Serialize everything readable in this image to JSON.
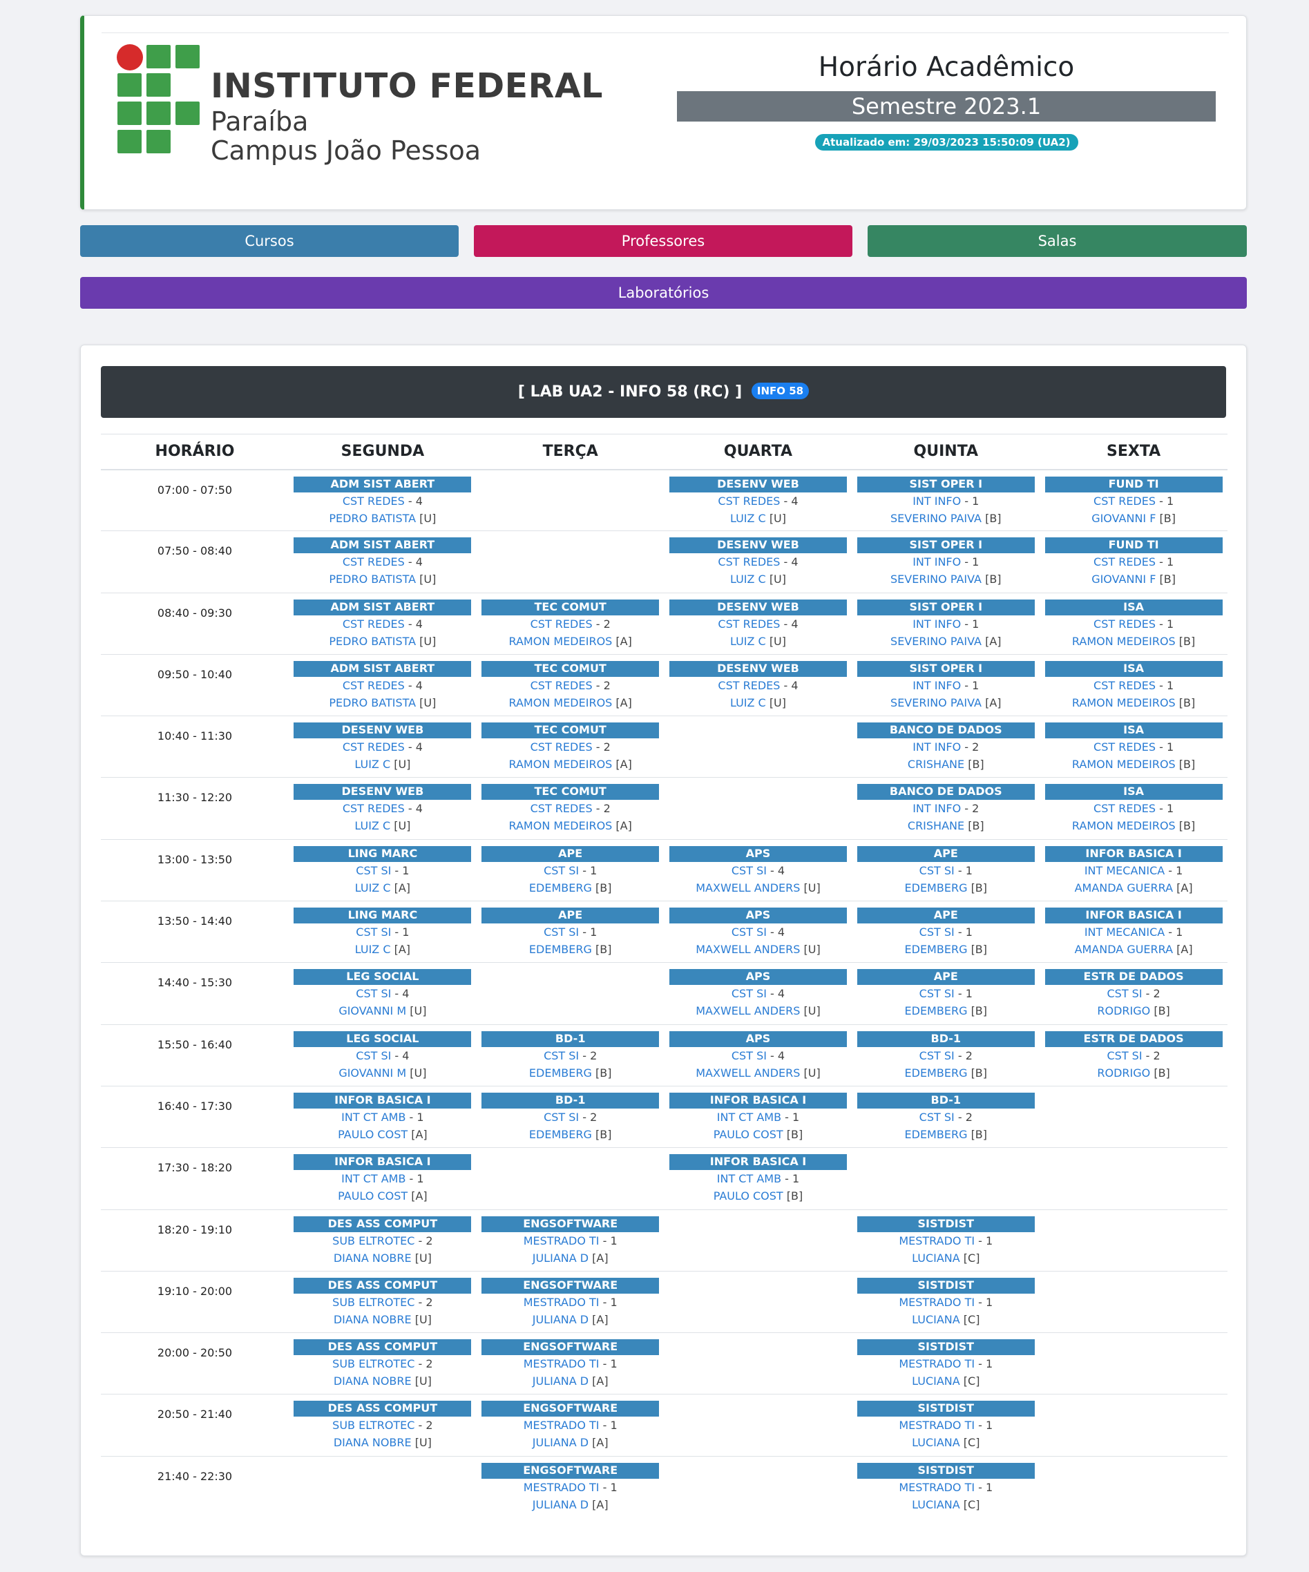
{
  "header": {
    "institution": "INSTITUTO FEDERAL",
    "state": "Paraíba",
    "campus": "Campus João Pessoa",
    "title": "Horário Acadêmico",
    "semester": "Semestre 2023.1",
    "updated": "Atualizado em: 29/03/2023 15:50:09 (UA2)"
  },
  "nav": {
    "cursos": "Cursos",
    "professores": "Professores",
    "salas": "Salas",
    "laboratorios": "Laboratórios"
  },
  "colors": {
    "cursos": "#3b7eab",
    "professores": "#c3185a",
    "salas": "#368662",
    "laboratorios": "#6a3bae",
    "discipline": "#3a87bb",
    "link": "#2a7cd4"
  },
  "room": {
    "title": "[ LAB UA2 - INFO 58 (RC) ]",
    "badge": "INFO 58"
  },
  "table": {
    "headers": [
      "HORÁRIO",
      "SEGUNDA",
      "TERÇA",
      "QUARTA",
      "QUINTA",
      "SEXTA"
    ],
    "rows": [
      {
        "time": "07:00 - 07:50",
        "days": [
          {
            "disc": "ADM SIST ABERT",
            "curso": "CST REDES",
            "periodo": "4",
            "prof": "PEDRO BATISTA",
            "turma": "[U]"
          },
          null,
          {
            "disc": "DESENV WEB",
            "curso": "CST REDES",
            "periodo": "4",
            "prof": "LUIZ C",
            "turma": "[U]"
          },
          {
            "disc": "SIST OPER I",
            "curso": "INT INFO",
            "periodo": "1",
            "prof": "SEVERINO PAIVA",
            "turma": "[B]"
          },
          {
            "disc": "FUND TI",
            "curso": "CST REDES",
            "periodo": "1",
            "prof": "GIOVANNI F",
            "turma": "[B]"
          }
        ]
      },
      {
        "time": "07:50 - 08:40",
        "days": [
          {
            "disc": "ADM SIST ABERT",
            "curso": "CST REDES",
            "periodo": "4",
            "prof": "PEDRO BATISTA",
            "turma": "[U]"
          },
          null,
          {
            "disc": "DESENV WEB",
            "curso": "CST REDES",
            "periodo": "4",
            "prof": "LUIZ C",
            "turma": "[U]"
          },
          {
            "disc": "SIST OPER I",
            "curso": "INT INFO",
            "periodo": "1",
            "prof": "SEVERINO PAIVA",
            "turma": "[B]"
          },
          {
            "disc": "FUND TI",
            "curso": "CST REDES",
            "periodo": "1",
            "prof": "GIOVANNI F",
            "turma": "[B]"
          }
        ]
      },
      {
        "time": "08:40 - 09:30",
        "days": [
          {
            "disc": "ADM SIST ABERT",
            "curso": "CST REDES",
            "periodo": "4",
            "prof": "PEDRO BATISTA",
            "turma": "[U]"
          },
          {
            "disc": "TEC COMUT",
            "curso": "CST REDES",
            "periodo": "2",
            "prof": "RAMON MEDEIROS",
            "turma": "[A]"
          },
          {
            "disc": "DESENV WEB",
            "curso": "CST REDES",
            "periodo": "4",
            "prof": "LUIZ C",
            "turma": "[U]"
          },
          {
            "disc": "SIST OPER I",
            "curso": "INT INFO",
            "periodo": "1",
            "prof": "SEVERINO PAIVA",
            "turma": "[A]"
          },
          {
            "disc": "ISA",
            "curso": "CST REDES",
            "periodo": "1",
            "prof": "RAMON MEDEIROS",
            "turma": "[B]"
          }
        ]
      },
      {
        "time": "09:50 - 10:40",
        "days": [
          {
            "disc": "ADM SIST ABERT",
            "curso": "CST REDES",
            "periodo": "4",
            "prof": "PEDRO BATISTA",
            "turma": "[U]"
          },
          {
            "disc": "TEC COMUT",
            "curso": "CST REDES",
            "periodo": "2",
            "prof": "RAMON MEDEIROS",
            "turma": "[A]"
          },
          {
            "disc": "DESENV WEB",
            "curso": "CST REDES",
            "periodo": "4",
            "prof": "LUIZ C",
            "turma": "[U]"
          },
          {
            "disc": "SIST OPER I",
            "curso": "INT INFO",
            "periodo": "1",
            "prof": "SEVERINO PAIVA",
            "turma": "[A]"
          },
          {
            "disc": "ISA",
            "curso": "CST REDES",
            "periodo": "1",
            "prof": "RAMON MEDEIROS",
            "turma": "[B]"
          }
        ]
      },
      {
        "time": "10:40 - 11:30",
        "days": [
          {
            "disc": "DESENV WEB",
            "curso": "CST REDES",
            "periodo": "4",
            "prof": "LUIZ C",
            "turma": "[U]"
          },
          {
            "disc": "TEC COMUT",
            "curso": "CST REDES",
            "periodo": "2",
            "prof": "RAMON MEDEIROS",
            "turma": "[A]"
          },
          null,
          {
            "disc": "BANCO DE DADOS",
            "curso": "INT INFO",
            "periodo": "2",
            "prof": "CRISHANE",
            "turma": "[B]"
          },
          {
            "disc": "ISA",
            "curso": "CST REDES",
            "periodo": "1",
            "prof": "RAMON MEDEIROS",
            "turma": "[B]"
          }
        ]
      },
      {
        "time": "11:30 - 12:20",
        "days": [
          {
            "disc": "DESENV WEB",
            "curso": "CST REDES",
            "periodo": "4",
            "prof": "LUIZ C",
            "turma": "[U]"
          },
          {
            "disc": "TEC COMUT",
            "curso": "CST REDES",
            "periodo": "2",
            "prof": "RAMON MEDEIROS",
            "turma": "[A]"
          },
          null,
          {
            "disc": "BANCO DE DADOS",
            "curso": "INT INFO",
            "periodo": "2",
            "prof": "CRISHANE",
            "turma": "[B]"
          },
          {
            "disc": "ISA",
            "curso": "CST REDES",
            "periodo": "1",
            "prof": "RAMON MEDEIROS",
            "turma": "[B]"
          }
        ]
      },
      {
        "time": "13:00 - 13:50",
        "days": [
          {
            "disc": "LING MARC",
            "curso": "CST SI",
            "periodo": "1",
            "prof": "LUIZ C",
            "turma": "[A]"
          },
          {
            "disc": "APE",
            "curso": "CST SI",
            "periodo": "1",
            "prof": "EDEMBERG",
            "turma": "[B]"
          },
          {
            "disc": "APS",
            "curso": "CST SI",
            "periodo": "4",
            "prof": "MAXWELL ANDERS",
            "turma": "[U]"
          },
          {
            "disc": "APE",
            "curso": "CST SI",
            "periodo": "1",
            "prof": "EDEMBERG",
            "turma": "[B]"
          },
          {
            "disc": "INFOR BASICA I",
            "curso": "INT MECANICA",
            "periodo": "1",
            "prof": "AMANDA GUERRA",
            "turma": "[A]"
          }
        ]
      },
      {
        "time": "13:50 - 14:40",
        "days": [
          {
            "disc": "LING MARC",
            "curso": "CST SI",
            "periodo": "1",
            "prof": "LUIZ C",
            "turma": "[A]"
          },
          {
            "disc": "APE",
            "curso": "CST SI",
            "periodo": "1",
            "prof": "EDEMBERG",
            "turma": "[B]"
          },
          {
            "disc": "APS",
            "curso": "CST SI",
            "periodo": "4",
            "prof": "MAXWELL ANDERS",
            "turma": "[U]"
          },
          {
            "disc": "APE",
            "curso": "CST SI",
            "periodo": "1",
            "prof": "EDEMBERG",
            "turma": "[B]"
          },
          {
            "disc": "INFOR BASICA I",
            "curso": "INT MECANICA",
            "periodo": "1",
            "prof": "AMANDA GUERRA",
            "turma": "[A]"
          }
        ]
      },
      {
        "time": "14:40 - 15:30",
        "days": [
          {
            "disc": "LEG SOCIAL",
            "curso": "CST SI",
            "periodo": "4",
            "prof": "GIOVANNI M",
            "turma": "[U]"
          },
          null,
          {
            "disc": "APS",
            "curso": "CST SI",
            "periodo": "4",
            "prof": "MAXWELL ANDERS",
            "turma": "[U]"
          },
          {
            "disc": "APE",
            "curso": "CST SI",
            "periodo": "1",
            "prof": "EDEMBERG",
            "turma": "[B]"
          },
          {
            "disc": "ESTR DE DADOS",
            "curso": "CST SI",
            "periodo": "2",
            "prof": "RODRIGO",
            "turma": "[B]"
          }
        ]
      },
      {
        "time": "15:50 - 16:40",
        "days": [
          {
            "disc": "LEG SOCIAL",
            "curso": "CST SI",
            "periodo": "4",
            "prof": "GIOVANNI M",
            "turma": "[U]"
          },
          {
            "disc": "BD-1",
            "curso": "CST SI",
            "periodo": "2",
            "prof": "EDEMBERG",
            "turma": "[B]"
          },
          {
            "disc": "APS",
            "curso": "CST SI",
            "periodo": "4",
            "prof": "MAXWELL ANDERS",
            "turma": "[U]"
          },
          {
            "disc": "BD-1",
            "curso": "CST SI",
            "periodo": "2",
            "prof": "EDEMBERG",
            "turma": "[B]"
          },
          {
            "disc": "ESTR DE DADOS",
            "curso": "CST SI",
            "periodo": "2",
            "prof": "RODRIGO",
            "turma": "[B]"
          }
        ]
      },
      {
        "time": "16:40 - 17:30",
        "days": [
          {
            "disc": "INFOR BASICA I",
            "curso": "INT CT AMB",
            "periodo": "1",
            "prof": "PAULO COST",
            "turma": "[A]"
          },
          {
            "disc": "BD-1",
            "curso": "CST SI",
            "periodo": "2",
            "prof": "EDEMBERG",
            "turma": "[B]"
          },
          {
            "disc": "INFOR BASICA I",
            "curso": "INT CT AMB",
            "periodo": "1",
            "prof": "PAULO COST",
            "turma": "[B]"
          },
          {
            "disc": "BD-1",
            "curso": "CST SI",
            "periodo": "2",
            "prof": "EDEMBERG",
            "turma": "[B]"
          },
          null
        ]
      },
      {
        "time": "17:30 - 18:20",
        "days": [
          {
            "disc": "INFOR BASICA I",
            "curso": "INT CT AMB",
            "periodo": "1",
            "prof": "PAULO COST",
            "turma": "[A]"
          },
          null,
          {
            "disc": "INFOR BASICA I",
            "curso": "INT CT AMB",
            "periodo": "1",
            "prof": "PAULO COST",
            "turma": "[B]"
          },
          null,
          null
        ]
      },
      {
        "time": "18:20 - 19:10",
        "days": [
          {
            "disc": "DES ASS COMPUT",
            "curso": "SUB ELTROTEC",
            "periodo": "2",
            "prof": "DIANA NOBRE",
            "turma": "[U]"
          },
          {
            "disc": "ENGSOFTWARE",
            "curso": "MESTRADO TI",
            "periodo": "1",
            "prof": "JULIANA D",
            "turma": "[A]"
          },
          null,
          {
            "disc": "SISTDIST",
            "curso": "MESTRADO TI",
            "periodo": "1",
            "prof": "LUCIANA",
            "turma": "[C]"
          },
          null
        ]
      },
      {
        "time": "19:10 - 20:00",
        "days": [
          {
            "disc": "DES ASS COMPUT",
            "curso": "SUB ELTROTEC",
            "periodo": "2",
            "prof": "DIANA NOBRE",
            "turma": "[U]"
          },
          {
            "disc": "ENGSOFTWARE",
            "curso": "MESTRADO TI",
            "periodo": "1",
            "prof": "JULIANA D",
            "turma": "[A]"
          },
          null,
          {
            "disc": "SISTDIST",
            "curso": "MESTRADO TI",
            "periodo": "1",
            "prof": "LUCIANA",
            "turma": "[C]"
          },
          null
        ]
      },
      {
        "time": "20:00 - 20:50",
        "days": [
          {
            "disc": "DES ASS COMPUT",
            "curso": "SUB ELTROTEC",
            "periodo": "2",
            "prof": "DIANA NOBRE",
            "turma": "[U]"
          },
          {
            "disc": "ENGSOFTWARE",
            "curso": "MESTRADO TI",
            "periodo": "1",
            "prof": "JULIANA D",
            "turma": "[A]"
          },
          null,
          {
            "disc": "SISTDIST",
            "curso": "MESTRADO TI",
            "periodo": "1",
            "prof": "LUCIANA",
            "turma": "[C]"
          },
          null
        ]
      },
      {
        "time": "20:50 - 21:40",
        "days": [
          {
            "disc": "DES ASS COMPUT",
            "curso": "SUB ELTROTEC",
            "periodo": "2",
            "prof": "DIANA NOBRE",
            "turma": "[U]"
          },
          {
            "disc": "ENGSOFTWARE",
            "curso": "MESTRADO TI",
            "periodo": "1",
            "prof": "JULIANA D",
            "turma": "[A]"
          },
          null,
          {
            "disc": "SISTDIST",
            "curso": "MESTRADO TI",
            "periodo": "1",
            "prof": "LUCIANA",
            "turma": "[C]"
          },
          null
        ]
      },
      {
        "time": "21:40 - 22:30",
        "days": [
          null,
          {
            "disc": "ENGSOFTWARE",
            "curso": "MESTRADO TI",
            "periodo": "1",
            "prof": "JULIANA D",
            "turma": "[A]"
          },
          null,
          {
            "disc": "SISTDIST",
            "curso": "MESTRADO TI",
            "periodo": "1",
            "prof": "LUCIANA",
            "turma": "[C]"
          },
          null
        ]
      }
    ]
  }
}
